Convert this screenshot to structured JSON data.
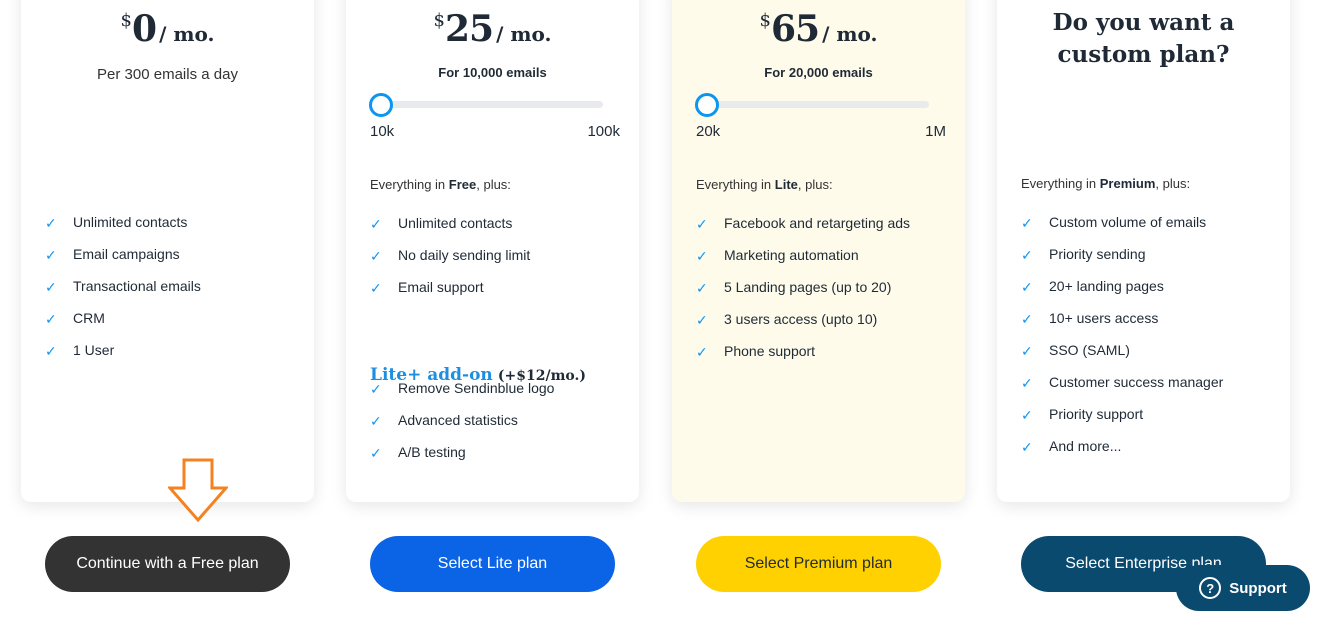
{
  "plans": {
    "free": {
      "currency": "$",
      "amount": "0",
      "period": "/ mo.",
      "subtitle": "Per 300 emails a day",
      "features": [
        "Unlimited contacts",
        "Email campaigns",
        "Transactional emails",
        "CRM",
        "1 User"
      ],
      "button": "Continue with a Free plan"
    },
    "lite": {
      "currency": "$",
      "amount": "25",
      "period": "/ mo.",
      "subtitle": "For 10,000 emails",
      "slider": {
        "min_label": "10k",
        "max_label": "100k",
        "value_fraction": 0
      },
      "lead_prefix": "Everything in ",
      "lead_plan": "Free",
      "lead_suffix": ", plus:",
      "features": [
        "Unlimited contacts",
        "No daily sending limit",
        "Email support"
      ],
      "addon": {
        "title": "Lite+ add-on",
        "price": "(+$12/mo.)",
        "features": [
          "Remove Sendinblue logo",
          "Advanced statistics",
          "A/B testing"
        ]
      },
      "button": "Select Lite plan"
    },
    "premium": {
      "currency": "$",
      "amount": "65",
      "period": "/ mo.",
      "subtitle": "For 20,000 emails",
      "slider": {
        "min_label": "20k",
        "max_label": "1M",
        "value_fraction": 0
      },
      "lead_prefix": "Everything in ",
      "lead_plan": "Lite",
      "lead_suffix": ", plus:",
      "features": [
        "Facebook and retargeting ads",
        "Marketing automation",
        "5 Landing pages (up to 20)",
        "3 users access (upto 10)",
        "Phone support"
      ],
      "button": "Select Premium plan"
    },
    "enterprise": {
      "heading_line1": "Do you want a",
      "heading_line2": "custom plan?",
      "lead_prefix": "Everything in ",
      "lead_plan": "Premium",
      "lead_suffix": ", plus:",
      "features": [
        "Custom volume of emails",
        "Priority sending",
        "20+ landing pages",
        "10+ users access",
        "SSO (SAML)",
        "Customer success manager",
        "Priority support",
        "And more..."
      ],
      "button": "Select Enterprise plan"
    }
  },
  "support": {
    "label": "Support",
    "icon": "?"
  },
  "icons": {
    "check": "✓",
    "pointer": "down-arrow-icon"
  },
  "colors": {
    "accent_blue": "#0b96f1",
    "lite_button": "#0b63e5",
    "premium_button": "#ffd100",
    "free_button": "#333333",
    "enterprise_button": "#0a4a6e",
    "arrow": "#f58220",
    "premium_card_bg": "#fefbeb"
  }
}
